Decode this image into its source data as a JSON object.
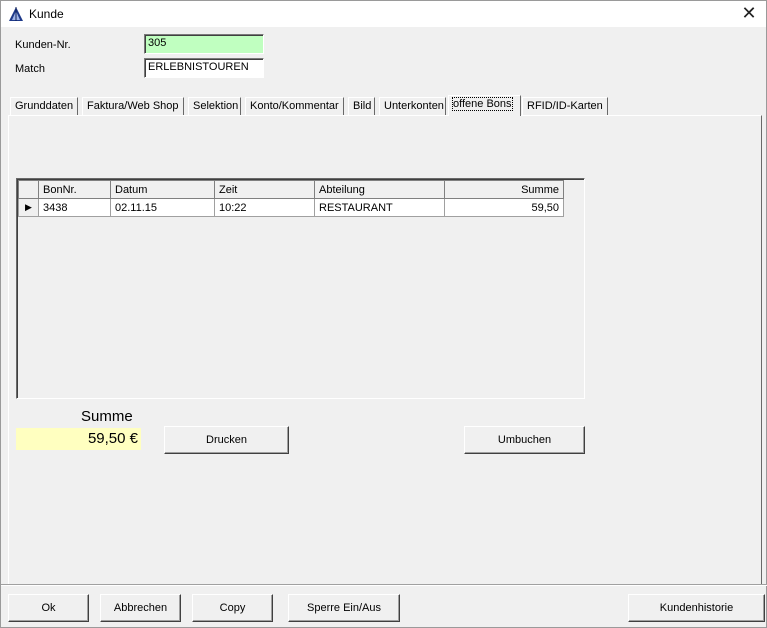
{
  "window": {
    "title": "Kunde",
    "close_symbol": "✕"
  },
  "customer": {
    "number_label": "Kunden-Nr.",
    "number_value": "305",
    "match_label": "Match",
    "match_value": "ERLEBNISTOUREN"
  },
  "tabs": [
    {
      "label": "Grunddaten"
    },
    {
      "label": "Faktura/Web Shop"
    },
    {
      "label": "Selektion"
    },
    {
      "label": "Konto/Kommentar"
    },
    {
      "label": "Bild"
    },
    {
      "label": "Unterkonten"
    },
    {
      "label": "offene Bons"
    },
    {
      "label": "RFID/ID-Karten"
    }
  ],
  "active_tab": "offene Bons",
  "grid": {
    "columns": [
      "BonNr.",
      "Datum",
      "Zeit",
      "Abteilung",
      "Summe"
    ],
    "rows": [
      {
        "indicator": "▶",
        "bon_nr": "3438",
        "datum": "02.11.15",
        "zeit": "10:22",
        "abteilung": "RESTAURANT",
        "summe": "59,50"
      }
    ]
  },
  "summary": {
    "label": "Summe",
    "value": "59,50 €"
  },
  "panel_buttons": {
    "print": "Drucken",
    "rebook": "Umbuchen"
  },
  "footer_buttons": {
    "ok": "Ok",
    "cancel": "Abbrechen",
    "copy": "Copy",
    "lock": "Sperre Ein/Aus",
    "history": "Kundenhistorie"
  },
  "colors": {
    "number_field_bg": "#c0ffc0",
    "sum_bg": "#ffffc0"
  }
}
